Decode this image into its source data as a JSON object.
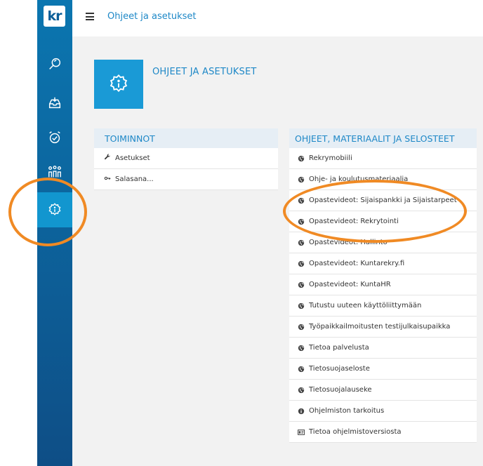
{
  "app": {
    "logo_text": "kr"
  },
  "nav": [
    {
      "icon": "search-icon"
    },
    {
      "icon": "inbox-icon"
    },
    {
      "icon": "alarm-clock-icon"
    },
    {
      "icon": "users-icon"
    },
    {
      "icon": "settings-info-icon",
      "active": true
    }
  ],
  "topbar": {
    "breadcrumb": "Ohjeet ja asetukset"
  },
  "page": {
    "title": "OHJEET JA ASETUKSET",
    "icon": "settings-info-icon"
  },
  "left_panel": {
    "title": "TOIMINNOT",
    "items": [
      {
        "label": "Asetukset",
        "icon": "wrench-icon"
      },
      {
        "label": "Salasana...",
        "icon": "key-icon"
      }
    ]
  },
  "right_panel": {
    "title": "OHJEET, MATERIAALIT JA SELOSTEET",
    "items": [
      {
        "label": "Rekrymobiili",
        "icon": "globe-icon"
      },
      {
        "label": "Ohje- ja koulutusmateriaalia",
        "icon": "globe-icon"
      },
      {
        "label": "Opastevideot: Sijaispankki ja Sijaistarpeet",
        "icon": "globe-icon"
      },
      {
        "label": "Opastevideot: Rekrytointi",
        "icon": "globe-icon"
      },
      {
        "label": "Opastevideot: Hallinto",
        "icon": "globe-icon"
      },
      {
        "label": "Opastevideot: Kuntarekry.fi",
        "icon": "globe-icon"
      },
      {
        "label": "Opastevideot: KuntaHR",
        "icon": "globe-icon"
      },
      {
        "label": "Tutustu uuteen käyttöliittymään",
        "icon": "globe-icon"
      },
      {
        "label": "Työpaikkailmoitusten testijulkaisupaikka",
        "icon": "globe-icon"
      },
      {
        "label": "Tietoa palvelusta",
        "icon": "globe-icon"
      },
      {
        "label": "Tietosuojaseloste",
        "icon": "globe-icon"
      },
      {
        "label": "Tietosuojalauseke",
        "icon": "globe-icon"
      },
      {
        "label": "Ohjelmiston tarkoitus",
        "icon": "info-icon"
      },
      {
        "label": "Tietoa ohjelmistoversiosta",
        "icon": "id-card-icon"
      }
    ]
  },
  "colors": {
    "accent": "#1e88c7",
    "sidebar": "#0b76b0",
    "active": "#1296cf",
    "annotation": "#f08a24"
  }
}
